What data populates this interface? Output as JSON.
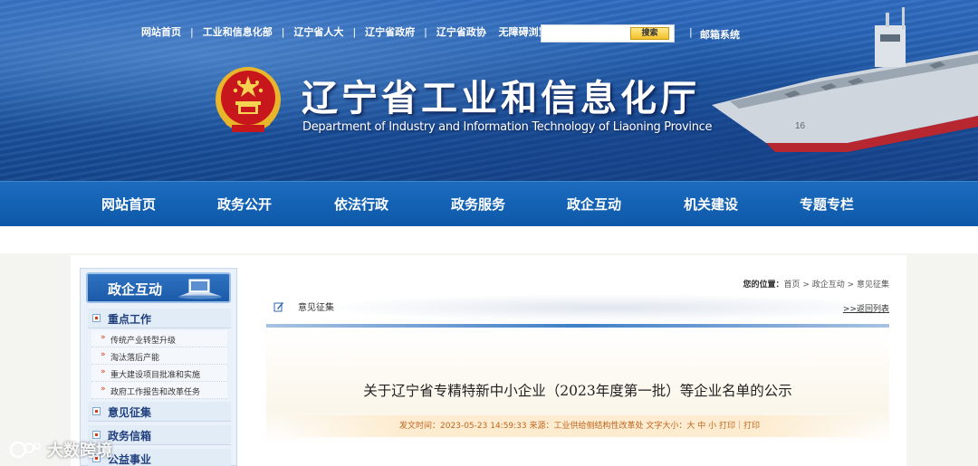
{
  "header": {
    "top_links": [
      "网站首页",
      "工业和信息化部",
      "辽宁省人大",
      "辽宁省政府",
      "辽宁省政协",
      "无障碍浏览"
    ],
    "search": {
      "placeholder": "",
      "button_label": "搜索"
    },
    "mail_link": "邮箱系统",
    "title": "辽宁省工业和信息化厅",
    "subtitle": "Department of Industry and Information Technology of Liaoning Province"
  },
  "nav": {
    "items": [
      "网站首页",
      "政务公开",
      "依法行政",
      "政务服务",
      "政企互动",
      "机关建设",
      "专题专栏"
    ]
  },
  "sidebar": {
    "title": "政企互动",
    "sections": [
      {
        "label": "重点工作",
        "subs": [
          "传统产业转型升级",
          "淘汰落后产能",
          "重大建设项目批准和实施",
          "政府工作报告和改革任务"
        ]
      },
      {
        "label": "意见征集"
      },
      {
        "label": "政务信箱"
      },
      {
        "label": "公益事业"
      }
    ]
  },
  "breadcrumb": {
    "prefix": "您的位置：",
    "path": "首页 > 政企互动 > 意见征集"
  },
  "article": {
    "section_title": "意见征集",
    "back_link": ">>返回列表",
    "title": "关于辽宁省专精特新中小企业（2023年度第一批）等企业名单的公示",
    "meta": "发文时间：2023-05-23 14:59:33 来源：工业供给侧结构性改革处 文字大小：大 中 小     打印｜打印"
  },
  "watermark": {
    "text": "大数跨境"
  },
  "colors": {
    "nav_blue": "#0d58a9",
    "banner_blue": "#1f5aa8",
    "meta_orange": "#c0651e",
    "accent_red": "#d23a1a"
  }
}
